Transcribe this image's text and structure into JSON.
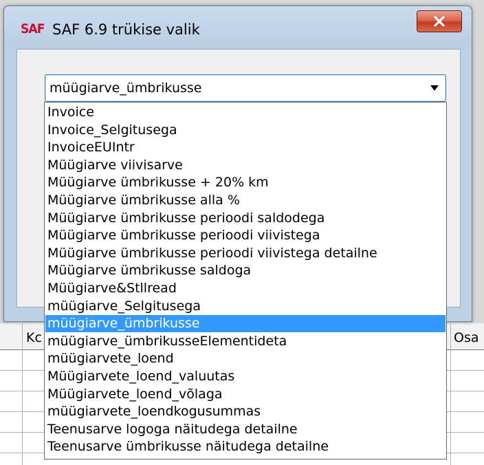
{
  "window": {
    "app_logo": "SAF",
    "title": "SAF 6.9 trükise valik",
    "close_icon": "close-icon"
  },
  "combobox": {
    "selected_value": "müügiarve_ümbrikusse",
    "arrow_icon": "chevron-down-icon"
  },
  "dropdown": {
    "selected_index": 12,
    "items": [
      "Invoice",
      "Invoice_Selgitusega",
      "InvoiceEUIntr",
      "Müügiarve viivisarve",
      "Müügiarve ümbrikusse + 20% km",
      "Müügiarve ümbrikusse alla %",
      "Müügiarve ümbrikusse perioodi saldodega",
      "Müügiarve ümbrikusse perioodi viivistega",
      "Müügiarve ümbrikusse perioodi viivistega detailne",
      "Müügiarve ümbrikusse saldoga",
      "Müügiarve&Stllread",
      "müügiarve_Selgitusega",
      "müügiarve_ümbrikusse",
      "müügiarve_ümbrikusseElementideta",
      "müügiarvete_loend",
      "Müügiarvete_loend_valuutas",
      "Müügiarvete_loend_võlaga",
      "müügiarvete_loendkogusummas",
      "Teenusarve logoga näitudega detailne",
      "Teenusarve ümbrikusse näitudega detailne"
    ]
  },
  "background_table": {
    "left_header": "Kc",
    "right_header": "Osa"
  },
  "colors": {
    "selection": "#3399ff",
    "close_button": "#c94a33",
    "logo": "#c8102e"
  }
}
